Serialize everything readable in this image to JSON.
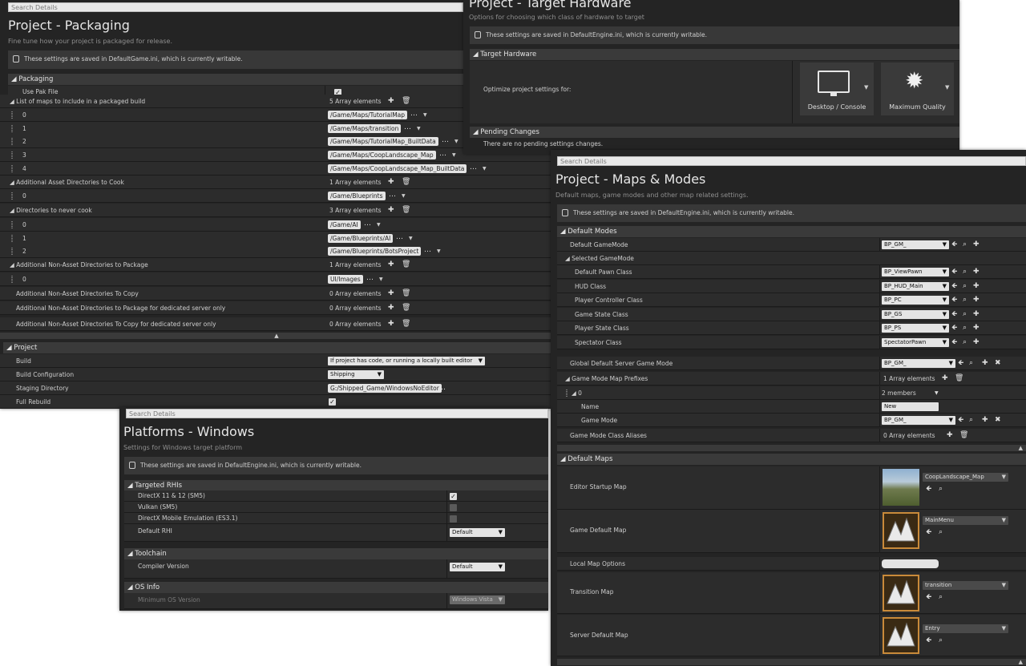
{
  "packaging": {
    "search_placeholder": "Search Details",
    "title": "Project - Packaging",
    "subtitle": "Fine tune how your project is packaged for release.",
    "notice": "These settings are saved in DefaultGame.ini, which is currently writable.",
    "packaging_header": "Packaging",
    "use_pak_label": "Use Pak File",
    "maps_label": "List of maps to include in a packaged build",
    "maps_count": "5 Array elements",
    "maps": [
      {
        "index": "0",
        "value": "/Game/Maps/TutorialMap"
      },
      {
        "index": "1",
        "value": "/Game/Maps/transition"
      },
      {
        "index": "2",
        "value": "/Game/Maps/TutorialMap_BuiltData"
      },
      {
        "index": "3",
        "value": "/Game/Maps/CoopLandscape_Map"
      },
      {
        "index": "4",
        "value": "/Game/Maps/CoopLandscape_Map_BuiltData"
      }
    ],
    "asset_dirs_label": "Additional Asset Directories to Cook",
    "asset_dirs_count": "1 Array elements",
    "asset_dirs": [
      {
        "index": "0",
        "value": "/Game/Blueprints"
      }
    ],
    "never_cook_label": "Directories to never cook",
    "never_cook_count": "3 Array elements",
    "never_cook": [
      {
        "index": "0",
        "value": "/Game/AI"
      },
      {
        "index": "1",
        "value": "/Game/Blueprints/AI"
      },
      {
        "index": "2",
        "value": "/Game/Blueprints/BotsProject"
      }
    ],
    "nonasset_pkg_label": "Additional Non-Asset Directories to Package",
    "nonasset_pkg_count": "1 Array elements",
    "nonasset_pkg": [
      {
        "index": "0",
        "value": "UI/Images"
      }
    ],
    "nonasset_copy_label": "Additional Non-Asset Directories To Copy",
    "nonasset_copy_count": "0 Array elements",
    "nonasset_server_label": "Additional Non-Asset Directories to Package for dedicated server only",
    "nonasset_server_count": "0 Array elements",
    "nonasset_copy_server_label": "Additional Non-Asset Directories To Copy for dedicated server only",
    "nonasset_copy_server_count": "0 Array elements",
    "project_header": "Project",
    "build_label": "Build",
    "build_value": "If project has code, or running a locally built editor",
    "buildcfg_label": "Build Configuration",
    "buildcfg_value": "Shipping",
    "staging_label": "Staging Directory",
    "staging_value": "G:/Shipped_Game/WindowsNoEditor",
    "fullrebuild_label": "Full Rebuild"
  },
  "hardware": {
    "title": "Project - Target Hardware",
    "subtitle": "Options for choosing which class of hardware to target",
    "notice": "These settings are saved in DefaultEngine.ini, which is currently writable.",
    "target_header": "Target Hardware",
    "optimize_label": "Optimize project settings for:",
    "desktop_label": "Desktop / Console",
    "quality_label": "Maximum Quality",
    "pending_header": "Pending Changes",
    "pending_text": "There are no pending settings changes."
  },
  "maps": {
    "search_placeholder": "Search Details",
    "title": "Project - Maps & Modes",
    "subtitle": "Default maps, game modes and other map related settings.",
    "notice": "These settings are saved in DefaultEngine.ini, which is currently writable.",
    "modes_header": "Default Modes",
    "default_gamemode_label": "Default GameMode",
    "default_gamemode_value": "BP_GM_",
    "selected_gamemode_label": "Selected GameMode",
    "classes": [
      {
        "label": "Default Pawn Class",
        "value": "BP_ViewPawn"
      },
      {
        "label": "HUD Class",
        "value": "BP_HUD_Main"
      },
      {
        "label": "Player Controller Class",
        "value": "BP_PC"
      },
      {
        "label": "Game State Class",
        "value": "BP_GS"
      },
      {
        "label": "Player State Class",
        "value": "BP_PS"
      },
      {
        "label": "Spectator Class",
        "value": "SpectatorPawn"
      }
    ],
    "server_gamemode_label": "Global Default Server Game Mode",
    "server_gamemode_value": "BP_GM_",
    "prefixes_label": "Game Mode Map Prefixes",
    "prefixes_count": "1 Array elements",
    "prefix_index": "0",
    "prefix_members": "2 members",
    "name_label": "Name",
    "name_value": "New",
    "gamemode_label": "Game Mode",
    "gamemode_value": "BP_GM_",
    "aliases_label": "Game Mode Class Aliases",
    "aliases_count": "0 Array elements",
    "maps_header": "Default Maps",
    "editor_map_label": "Editor Startup Map",
    "editor_map_value": "CoopLandscape_Map",
    "game_map_label": "Game Default Map",
    "game_map_value": "MainMenu",
    "local_options_label": "Local Map Options",
    "transition_label": "Transition Map",
    "transition_value": "transition",
    "server_map_label": "Server Default Map",
    "server_map_value": "Entry"
  },
  "windows": {
    "search_placeholder": "Search Details",
    "title": "Platforms - Windows",
    "subtitle": "Settings for Windows target platform",
    "notice": "These settings are saved in DefaultEngine.ini, which is currently writable.",
    "rhi_header": "Targeted RHIs",
    "dx_label": "DirectX 11 & 12 (SM5)",
    "vulkan_label": "Vulkan (SM5)",
    "mobile_label": "DirectX Mobile Emulation (ES3.1)",
    "default_rhi_label": "Default RHI",
    "default_rhi_value": "Default",
    "toolchain_header": "Toolchain",
    "compiler_label": "Compiler Version",
    "compiler_value": "Default",
    "os_header": "OS Info",
    "min_os_label": "Minimum OS Version",
    "min_os_value": "Windows Vista"
  }
}
